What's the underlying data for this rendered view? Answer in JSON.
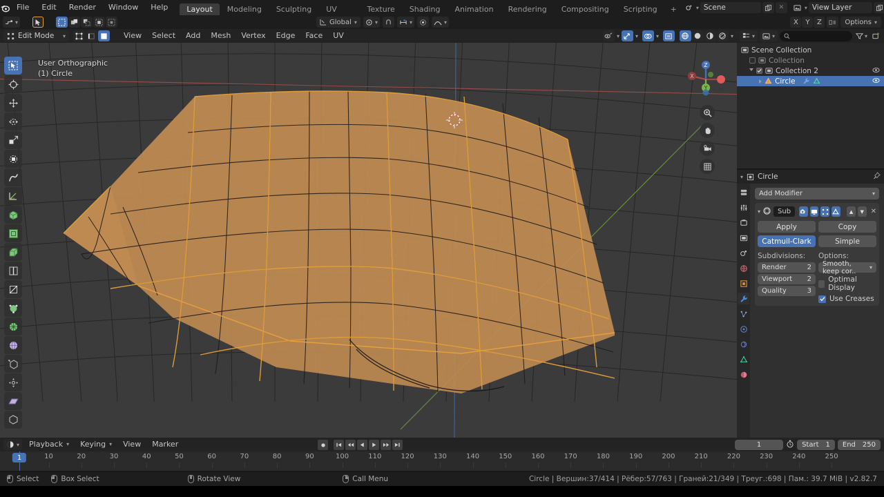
{
  "app": {
    "name": "Blender",
    "version": "v2.82.7"
  },
  "topbar": {
    "logo_icon": "blender-logo-icon",
    "menus": [
      "File",
      "Edit",
      "Render",
      "Window",
      "Help"
    ],
    "workspace_tabs": [
      {
        "label": "Layout",
        "active": true
      },
      {
        "label": "Modeling",
        "active": false
      },
      {
        "label": "Sculpting",
        "active": false
      },
      {
        "label": "UV Editing",
        "active": false
      },
      {
        "label": "Texture Paint",
        "active": false
      },
      {
        "label": "Shading",
        "active": false
      },
      {
        "label": "Animation",
        "active": false
      },
      {
        "label": "Rendering",
        "active": false
      },
      {
        "label": "Compositing",
        "active": false
      },
      {
        "label": "Scripting",
        "active": false
      },
      {
        "label": "+",
        "active": false
      }
    ],
    "scene": {
      "icon": "scene-icon",
      "name": "Scene",
      "new_icon": "duplicate-icon",
      "remove_icon": "x-icon"
    },
    "view_layer": {
      "icon": "view-layer-icon",
      "name": "View Layer",
      "new_icon": "duplicate-icon",
      "remove_icon": "x-icon"
    }
  },
  "tool_header": {
    "editor_type_icon": "editor-type-icon",
    "cursor_icon": "tweak-cursor-icon",
    "select_modes": [
      "select-box-icon",
      "select-extend-icon",
      "select-subtract-icon",
      "select-invert-icon",
      "select-intersect-icon"
    ],
    "transform_orientation": {
      "icon": "orientation-icon",
      "value": "Global"
    },
    "pivot_icon": "pivot-point-icon",
    "snap_magnet_icon": "snap-magnet-icon",
    "snap_target_icon": "snap-target-icon",
    "proportional_icon": "proportional-edit-icon",
    "falloff_icon": "falloff-curve-icon",
    "axis_labels": [
      "X",
      "Y",
      "Z"
    ],
    "options_label": "Options"
  },
  "viewport_header": {
    "mode": "Edit Mode",
    "mode_icon": "edit-mode-icon",
    "mesh_select_modes": [
      {
        "icon": "vertex-select-icon",
        "active": false
      },
      {
        "icon": "edge-select-icon",
        "active": false
      },
      {
        "icon": "face-select-icon",
        "active": true
      }
    ],
    "menus": [
      "View",
      "Select",
      "Add",
      "Mesh",
      "Vertex",
      "Edge",
      "Face",
      "UV"
    ],
    "right_controls": [
      {
        "icon": "visibility-icon",
        "active": false
      },
      {
        "icon": "gizmo-icon",
        "active": true
      },
      {
        "icon": "overlays-icon",
        "active": true
      },
      {
        "icon": "xray-toggle-icon",
        "active": true
      }
    ],
    "shading_modes": [
      {
        "icon": "shading-wireframe-icon",
        "active": true
      },
      {
        "icon": "shading-solid-icon",
        "active": false
      },
      {
        "icon": "shading-material-icon",
        "active": false
      },
      {
        "icon": "shading-rendered-icon",
        "active": false
      }
    ]
  },
  "viewport": {
    "overlay_line1": "User Orthographic",
    "overlay_line2": "(1) Circle",
    "gizmo_axes": [
      "X",
      "Y",
      "Z"
    ],
    "nav_buttons": [
      "zoom-icon",
      "pan-hand-icon",
      "camera-icon",
      "grid-ortho-icon"
    ],
    "cursor_3d_icon": "3d-cursor-icon",
    "colors": {
      "background": "#3b3b3b",
      "mesh_selected": "#c08b52",
      "wire": "#1e1a16",
      "edge_selected": "#e8a33d",
      "axis_x": "#c45b5b",
      "axis_y": "#7ab648",
      "axis_z": "#4772b3"
    },
    "tools": [
      {
        "icon": "tweak-select-icon",
        "active": true
      },
      {
        "icon": "cursor-tool-icon",
        "active": false
      },
      {
        "icon": "move-tool-icon",
        "active": false
      },
      {
        "icon": "rotate-tool-icon",
        "active": false
      },
      {
        "icon": "scale-tool-icon",
        "active": false
      },
      {
        "icon": "transform-tool-icon",
        "active": false
      },
      {
        "icon": "annotate-tool-icon",
        "active": false
      },
      {
        "icon": "measure-tool-icon",
        "active": false
      },
      {
        "icon": "extrude-region-icon",
        "active": false
      },
      {
        "icon": "inset-faces-icon",
        "active": false
      },
      {
        "icon": "bevel-icon",
        "active": false
      },
      {
        "icon": "loop-cut-icon",
        "active": false
      },
      {
        "icon": "knife-icon",
        "active": false
      },
      {
        "icon": "poly-build-icon",
        "active": false
      },
      {
        "icon": "spin-icon",
        "active": false
      },
      {
        "icon": "smooth-icon",
        "active": false
      },
      {
        "icon": "edge-slide-icon",
        "active": false
      },
      {
        "icon": "shrink-fatten-icon",
        "active": false
      },
      {
        "icon": "shear-icon",
        "active": false
      },
      {
        "icon": "rip-region-icon",
        "active": false
      }
    ]
  },
  "outliner": {
    "header_icons": [
      "display-mode-icon",
      "filter-id-icon",
      "search-icon",
      "filter-icon",
      "new-collection-icon"
    ],
    "search_placeholder": "",
    "rows": [
      {
        "label": "Scene Collection",
        "indent": 1,
        "icon": "scene-collection-icon",
        "checkbox": null,
        "selected": false,
        "expand": null,
        "eye": false
      },
      {
        "label": "Collection",
        "indent": 2,
        "icon": "collection-icon",
        "checkbox": false,
        "selected": false,
        "expand": null,
        "eye": false,
        "dim": true
      },
      {
        "label": "Collection 2",
        "indent": 2,
        "icon": "collection-icon",
        "checkbox": true,
        "selected": false,
        "expand": "down",
        "eye": true
      },
      {
        "label": "Circle",
        "indent": 3,
        "icon": "mesh-object-icon",
        "checkbox": null,
        "selected": true,
        "expand": "right",
        "eye": true,
        "badges": [
          "modifier-wrench-icon",
          "mesh-data-icon"
        ]
      }
    ]
  },
  "properties": {
    "breadcrumb_icon": "object-icon",
    "breadcrumb": "Circle",
    "pin_icon": "pin-icon",
    "tabs": [
      {
        "icon": "tool-tab-icon",
        "active": false
      },
      {
        "icon": "render-tab-icon",
        "active": false
      },
      {
        "icon": "output-tab-icon",
        "active": false
      },
      {
        "icon": "view-layer-tab-icon",
        "active": false
      },
      {
        "icon": "scene-tab-icon",
        "active": false
      },
      {
        "icon": "world-tab-icon",
        "active": false
      },
      {
        "icon": "object-tab-icon",
        "active": false
      },
      {
        "icon": "modifier-tab-icon",
        "active": true
      },
      {
        "icon": "particles-tab-icon",
        "active": false
      },
      {
        "icon": "physics-tab-icon",
        "active": false
      },
      {
        "icon": "constraints-tab-icon",
        "active": false
      },
      {
        "icon": "data-tab-icon",
        "active": false
      },
      {
        "icon": "material-tab-icon",
        "active": false
      }
    ],
    "add_modifier_label": "Add Modifier",
    "modifier": {
      "expand_icon": "collapse-triangle-icon",
      "type_icon": "subsurf-icon",
      "name": "Sub",
      "toggles": [
        {
          "icon": "render-toggle-icon",
          "active": true
        },
        {
          "icon": "realtime-toggle-icon",
          "active": true
        },
        {
          "icon": "edit-mode-toggle-icon",
          "active": true
        },
        {
          "icon": "on-cage-toggle-icon",
          "active": false
        }
      ],
      "move_up_icon": "move-up-icon",
      "move_down_icon": "move-down-icon",
      "delete_icon": "x-icon",
      "apply_label": "Apply",
      "copy_label": "Copy",
      "algorithms": [
        {
          "label": "Catmull-Clark",
          "active": true
        },
        {
          "label": "Simple",
          "active": false
        }
      ],
      "subdivisions_label": "Subdivisions:",
      "options_label": "Options:",
      "fields": [
        {
          "label": "Render",
          "value": "2"
        },
        {
          "label": "Viewport",
          "value": "2"
        },
        {
          "label": "Quality",
          "value": "3"
        }
      ],
      "uv_smooth": "Smooth, keep cor..",
      "optimal_display": {
        "label": "Optimal Display",
        "checked": false
      },
      "use_creases": {
        "label": "Use Creases",
        "checked": true
      }
    }
  },
  "timeline": {
    "editor_icon": "timeline-editor-icon",
    "menus": [
      "Playback",
      "Keying",
      "View",
      "Marker"
    ],
    "playback_buttons": [
      "record-icon",
      "jump-start-icon",
      "prev-keyframe-icon",
      "play-reverse-icon",
      "play-icon",
      "next-keyframe-icon",
      "jump-end-icon"
    ],
    "current_frame": "1",
    "use_preview_icon": "stopwatch-icon",
    "start_label": "Start",
    "start_value": "1",
    "end_label": "End",
    "end_value": "250",
    "ruler_ticks": [
      10,
      20,
      30,
      40,
      50,
      60,
      70,
      80,
      90,
      100,
      110,
      120,
      130,
      140,
      150,
      160,
      170,
      180,
      190,
      200,
      210,
      220,
      230,
      240,
      250
    ],
    "playhead_frame": "1"
  },
  "status_bar": {
    "keymap": [
      {
        "icon": "mouse-left-icon",
        "label": "Select"
      },
      {
        "icon": "mouse-left-drag-icon",
        "label": "Box Select"
      },
      {
        "icon": "mouse-middle-icon",
        "label": "Rotate View"
      },
      {
        "icon": "mouse-right-icon",
        "label": "Call Menu"
      }
    ],
    "stats": "Circle | Вершин:37/414 | Рёбер:57/763 | Граней:21/349 | Треуг.:698 | Пам.: 39.7 MiB | v2.82.7"
  }
}
